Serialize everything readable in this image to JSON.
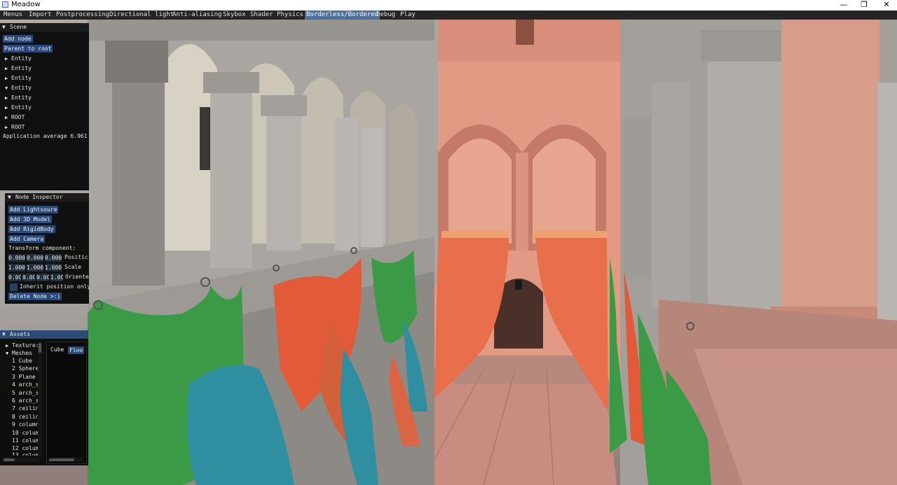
{
  "window": {
    "title": "Meadow",
    "minimize": "—",
    "maximize": "❐",
    "close": "✕"
  },
  "menubar": [
    "Menus",
    "Import",
    "Postprocessing",
    "Directional light",
    "Anti-aliasing",
    "Skybox",
    "Shader",
    "Physics",
    "Borderless/Bordered",
    "Debug",
    "Play"
  ],
  "menubar_active": "Borderless/Bordered",
  "scene": {
    "title": "Scene",
    "add_node": "Add node",
    "parent_to_root": "Parent to root",
    "nodes": [
      {
        "arrow": "▶",
        "label": "Entity"
      },
      {
        "arrow": "▶",
        "label": "Entity"
      },
      {
        "arrow": "▶",
        "label": "Entity"
      },
      {
        "arrow": "▼",
        "label": "Entity"
      },
      {
        "arrow": "▶",
        "label": "Entity"
      },
      {
        "arrow": "▶",
        "label": "Entity"
      },
      {
        "arrow": "▶",
        "label": "ROOT"
      },
      {
        "arrow": "▶",
        "label": "ROOT"
      }
    ],
    "app_average": "Application average 6.961"
  },
  "inspector": {
    "title": "Node Inspector",
    "add_lightsource": "Add Lightsoure",
    "add_3d_model": "Add 3D Model",
    "add_rigidbody": "Add RigidBody",
    "add_camera": "Add Camera",
    "transform_label": "Transform component:",
    "position": {
      "values": [
        "0.000",
        "0.000",
        "0.000"
      ],
      "label": "Positic"
    },
    "scale": {
      "values": [
        "1.000",
        "1.000",
        "1.000"
      ],
      "label": "Scale"
    },
    "orientation": {
      "values": [
        "0.0C",
        "0.0C",
        "0.0C",
        "1.0C"
      ],
      "label": "Oriente"
    },
    "inherit_label": "Inherit position only",
    "delete_node": "Delete Node >:)"
  },
  "assets": {
    "title": "Assets",
    "textures": "Texture:",
    "meshes": "Meshes",
    "mesh_items": [
      "1 Cube",
      "2 Sphere",
      "3 Plane",
      "4 arch_s",
      "5 arch_s",
      "6 arch_s",
      "7 ceilin",
      "8 ceilin",
      "9 column",
      "10 colum",
      "11 colum",
      "12 colum",
      "13 colum"
    ],
    "right_items": [
      "Cube",
      "Floo"
    ],
    "right_selected": "Floo"
  }
}
